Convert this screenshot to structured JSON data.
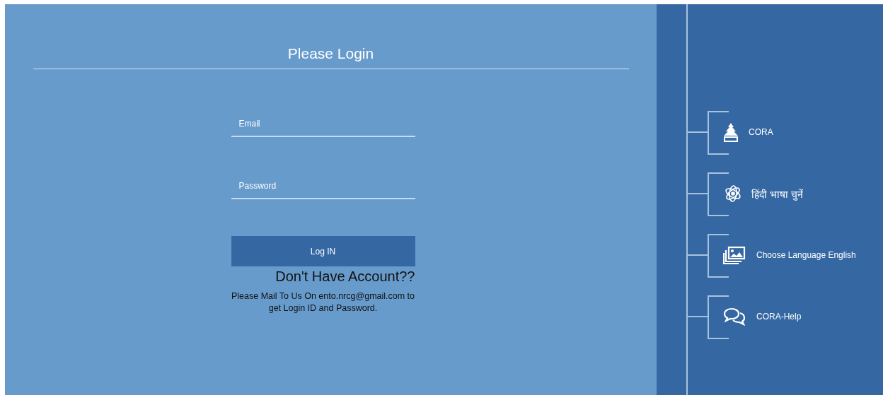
{
  "login": {
    "title": "Please Login",
    "fields": [
      {
        "placeholder": "Email"
      },
      {
        "placeholder": "Password"
      }
    ],
    "button": "Log IN",
    "no_account": "Don't Have Account??",
    "message": "Please Mail To Us On ento.nrcg@gmail.com to get Login ID and Password."
  },
  "sidebar": {
    "items": [
      {
        "label": "CORA",
        "kind": "tree"
      },
      {
        "label": "हिंदी भाषा चुनें",
        "kind": "atom"
      },
      {
        "label": "Choose Language English",
        "kind": "images"
      },
      {
        "label": "CORA-Help",
        "kind": "chat"
      }
    ]
  }
}
